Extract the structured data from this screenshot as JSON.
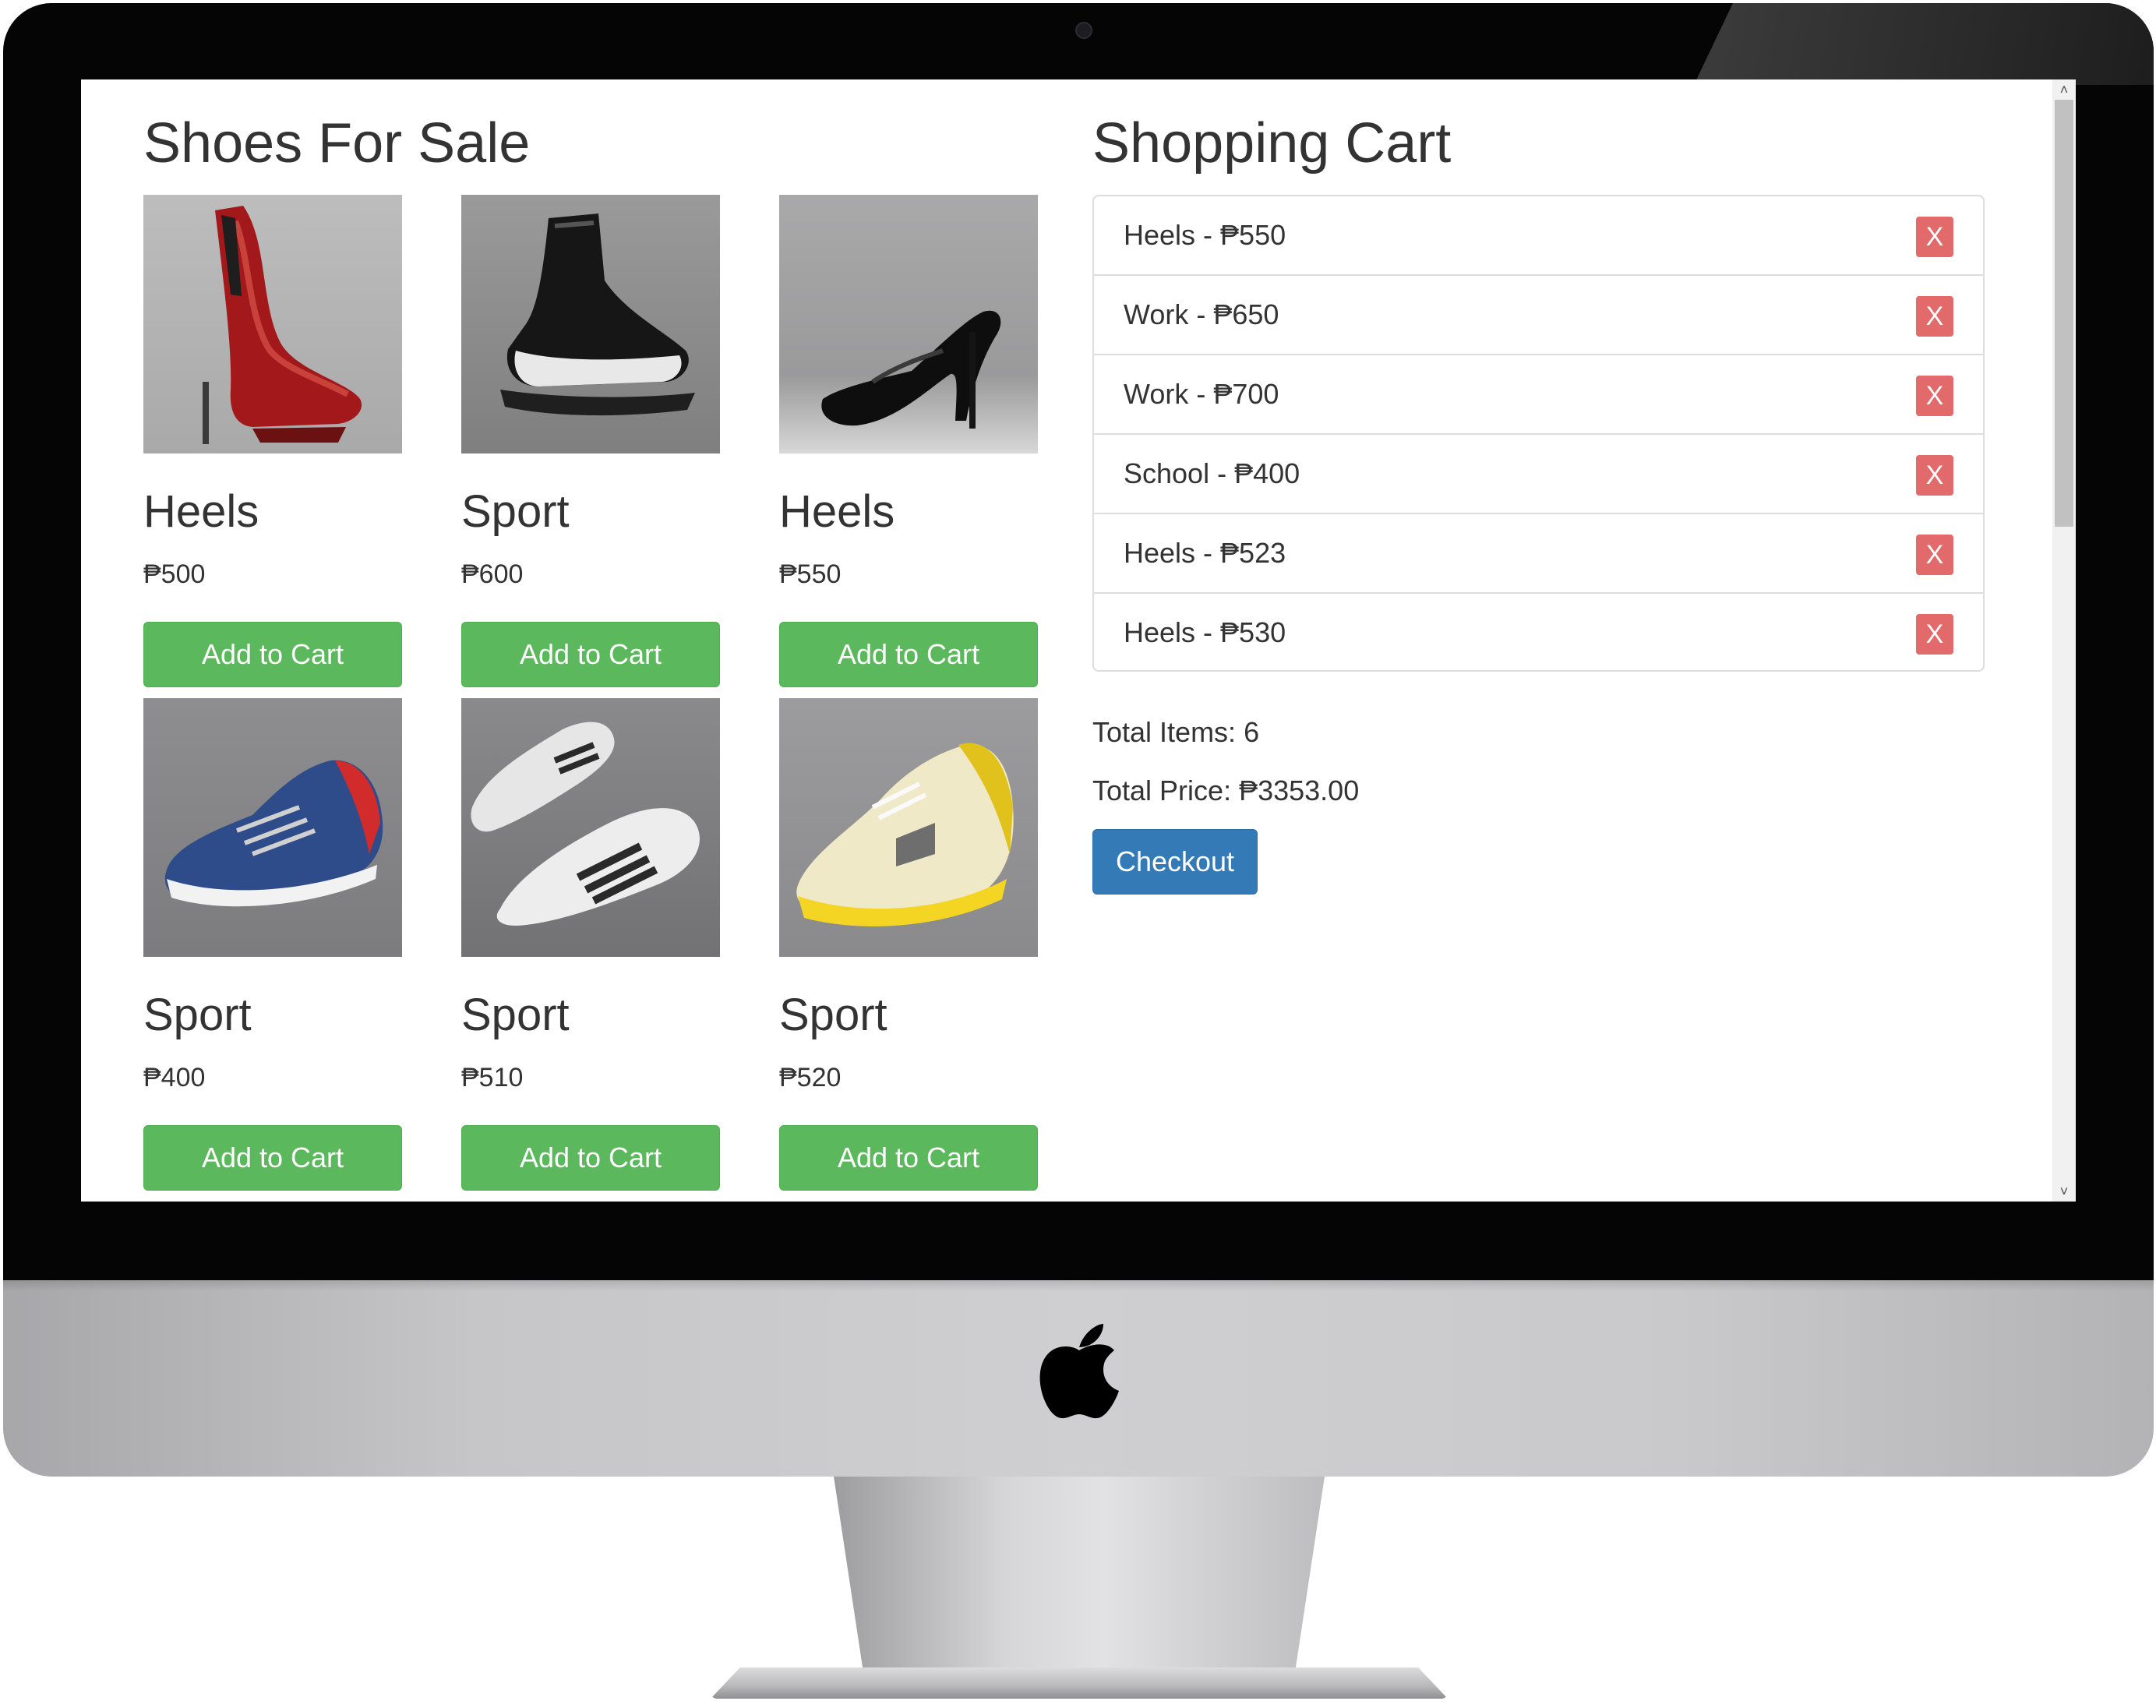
{
  "products": {
    "heading": "Shoes For Sale",
    "add_label": "Add to Cart",
    "items": [
      {
        "name": "Heels",
        "price": "₱500"
      },
      {
        "name": "Sport",
        "price": "₱600"
      },
      {
        "name": "Heels",
        "price": "₱550"
      },
      {
        "name": "Sport",
        "price": "₱400"
      },
      {
        "name": "Sport",
        "price": "₱510"
      },
      {
        "name": "Sport",
        "price": "₱520"
      }
    ]
  },
  "cart": {
    "heading": "Shopping Cart",
    "remove_label": "X",
    "items": [
      {
        "label": "Heels - ₱550"
      },
      {
        "label": "Work - ₱650"
      },
      {
        "label": "Work - ₱700"
      },
      {
        "label": "School - ₱400"
      },
      {
        "label": "Heels - ₱523"
      },
      {
        "label": "Heels - ₱530"
      }
    ],
    "total_items": "Total Items: 6",
    "total_price": "Total Price: ₱3353.00",
    "checkout_label": "Checkout"
  },
  "colors": {
    "add_button": "#5cb85c",
    "remove_button": "#e36a6a",
    "checkout_button": "#337ab7"
  }
}
